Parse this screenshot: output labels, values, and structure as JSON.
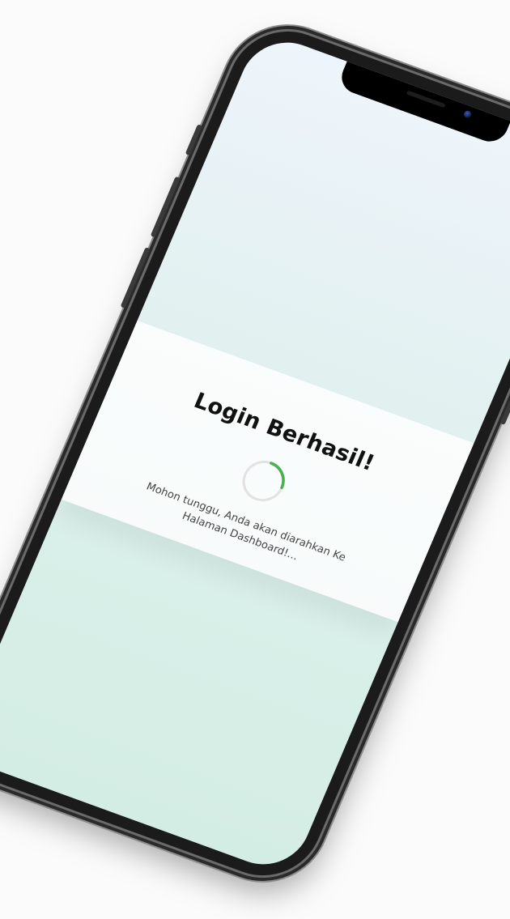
{
  "login": {
    "title": "Login Berhasil!",
    "message_line_1": "Mohon tunggu, Anda akan diarahkan Ke",
    "message_line_2": "Halaman Dashboard!..."
  },
  "spinner": {
    "progress_fraction": 0.25,
    "track_color": "#e2e2e2",
    "arc_color": "#4caf50"
  },
  "colors": {
    "screen_top": "#eef4fb",
    "screen_bottom": "#d4ede4"
  }
}
